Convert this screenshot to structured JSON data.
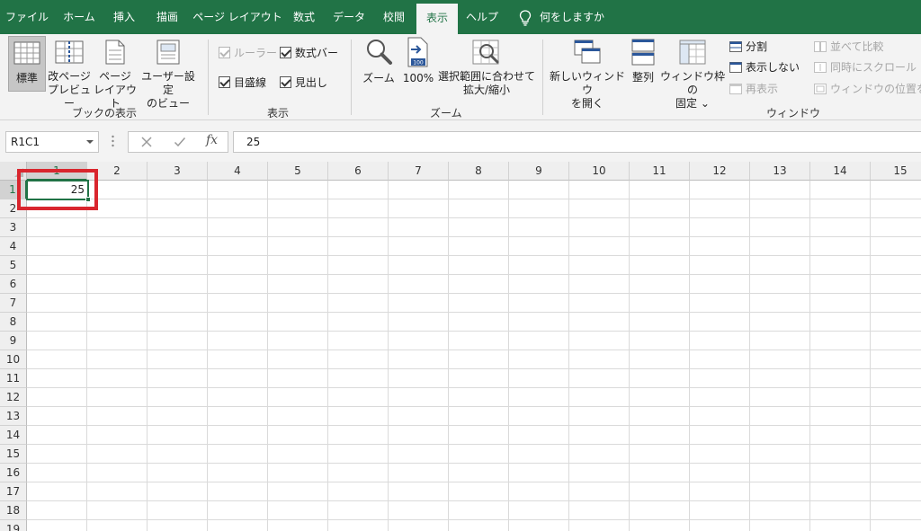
{
  "tabs": [
    {
      "label": "ファイル",
      "active": false
    },
    {
      "label": "ホーム",
      "active": false
    },
    {
      "label": "挿入",
      "active": false
    },
    {
      "label": "描画",
      "active": false
    },
    {
      "label": "ページ レイアウト",
      "active": false
    },
    {
      "label": "数式",
      "active": false
    },
    {
      "label": "データ",
      "active": false
    },
    {
      "label": "校閲",
      "active": false
    },
    {
      "label": "表示",
      "active": true
    },
    {
      "label": "ヘルプ",
      "active": false
    }
  ],
  "tell_me": "何をしますか",
  "ribbon": {
    "workbook_views": {
      "group_label": "ブックの表示",
      "normal": "標準",
      "page_break_1": "改ページ",
      "page_break_2": "プレビュー",
      "page_layout_1": "ページ",
      "page_layout_2": "レイアウト",
      "custom_1": "ユーザー設定",
      "custom_2": "のビュー"
    },
    "show": {
      "group_label": "表示",
      "ruler": "ルーラー",
      "formula_bar": "数式バー",
      "gridlines": "目盛線",
      "headings": "見出し"
    },
    "zoom": {
      "group_label": "ズーム",
      "zoom": "ズーム",
      "hundred": "100%",
      "zoom_badge": "100",
      "selection_1": "選択範囲に合わせて",
      "selection_2": "拡大/縮小"
    },
    "window": {
      "group_label": "ウィンドウ",
      "new_window_1": "新しいウィンドウ",
      "new_window_2": "を開く",
      "arrange": "整列",
      "freeze_1": "ウィンドウ枠の",
      "freeze_2": "固定",
      "freeze_caret": "⌄",
      "split": "分割",
      "hide": "表示しない",
      "unhide": "再表示",
      "side_by_side": "並べて比較",
      "sync_scroll": "同時にスクロール",
      "reset_position": "ウィンドウの位置を元"
    }
  },
  "formula_bar": {
    "name_box": "R1C1",
    "fx_label": "fx",
    "value": "25"
  },
  "grid": {
    "columns": [
      "1",
      "2",
      "3",
      "4",
      "5",
      "6",
      "7",
      "8",
      "9",
      "10",
      "11",
      "12",
      "13",
      "14",
      "15"
    ],
    "rows": [
      "1",
      "2",
      "3",
      "4",
      "5",
      "6",
      "7",
      "8",
      "9",
      "10",
      "11",
      "12",
      "13",
      "14",
      "15",
      "16",
      "17",
      "18",
      "19"
    ],
    "active_cell_value": "25"
  },
  "colors": {
    "accent": "#217346",
    "highlight": "#d9262e"
  }
}
